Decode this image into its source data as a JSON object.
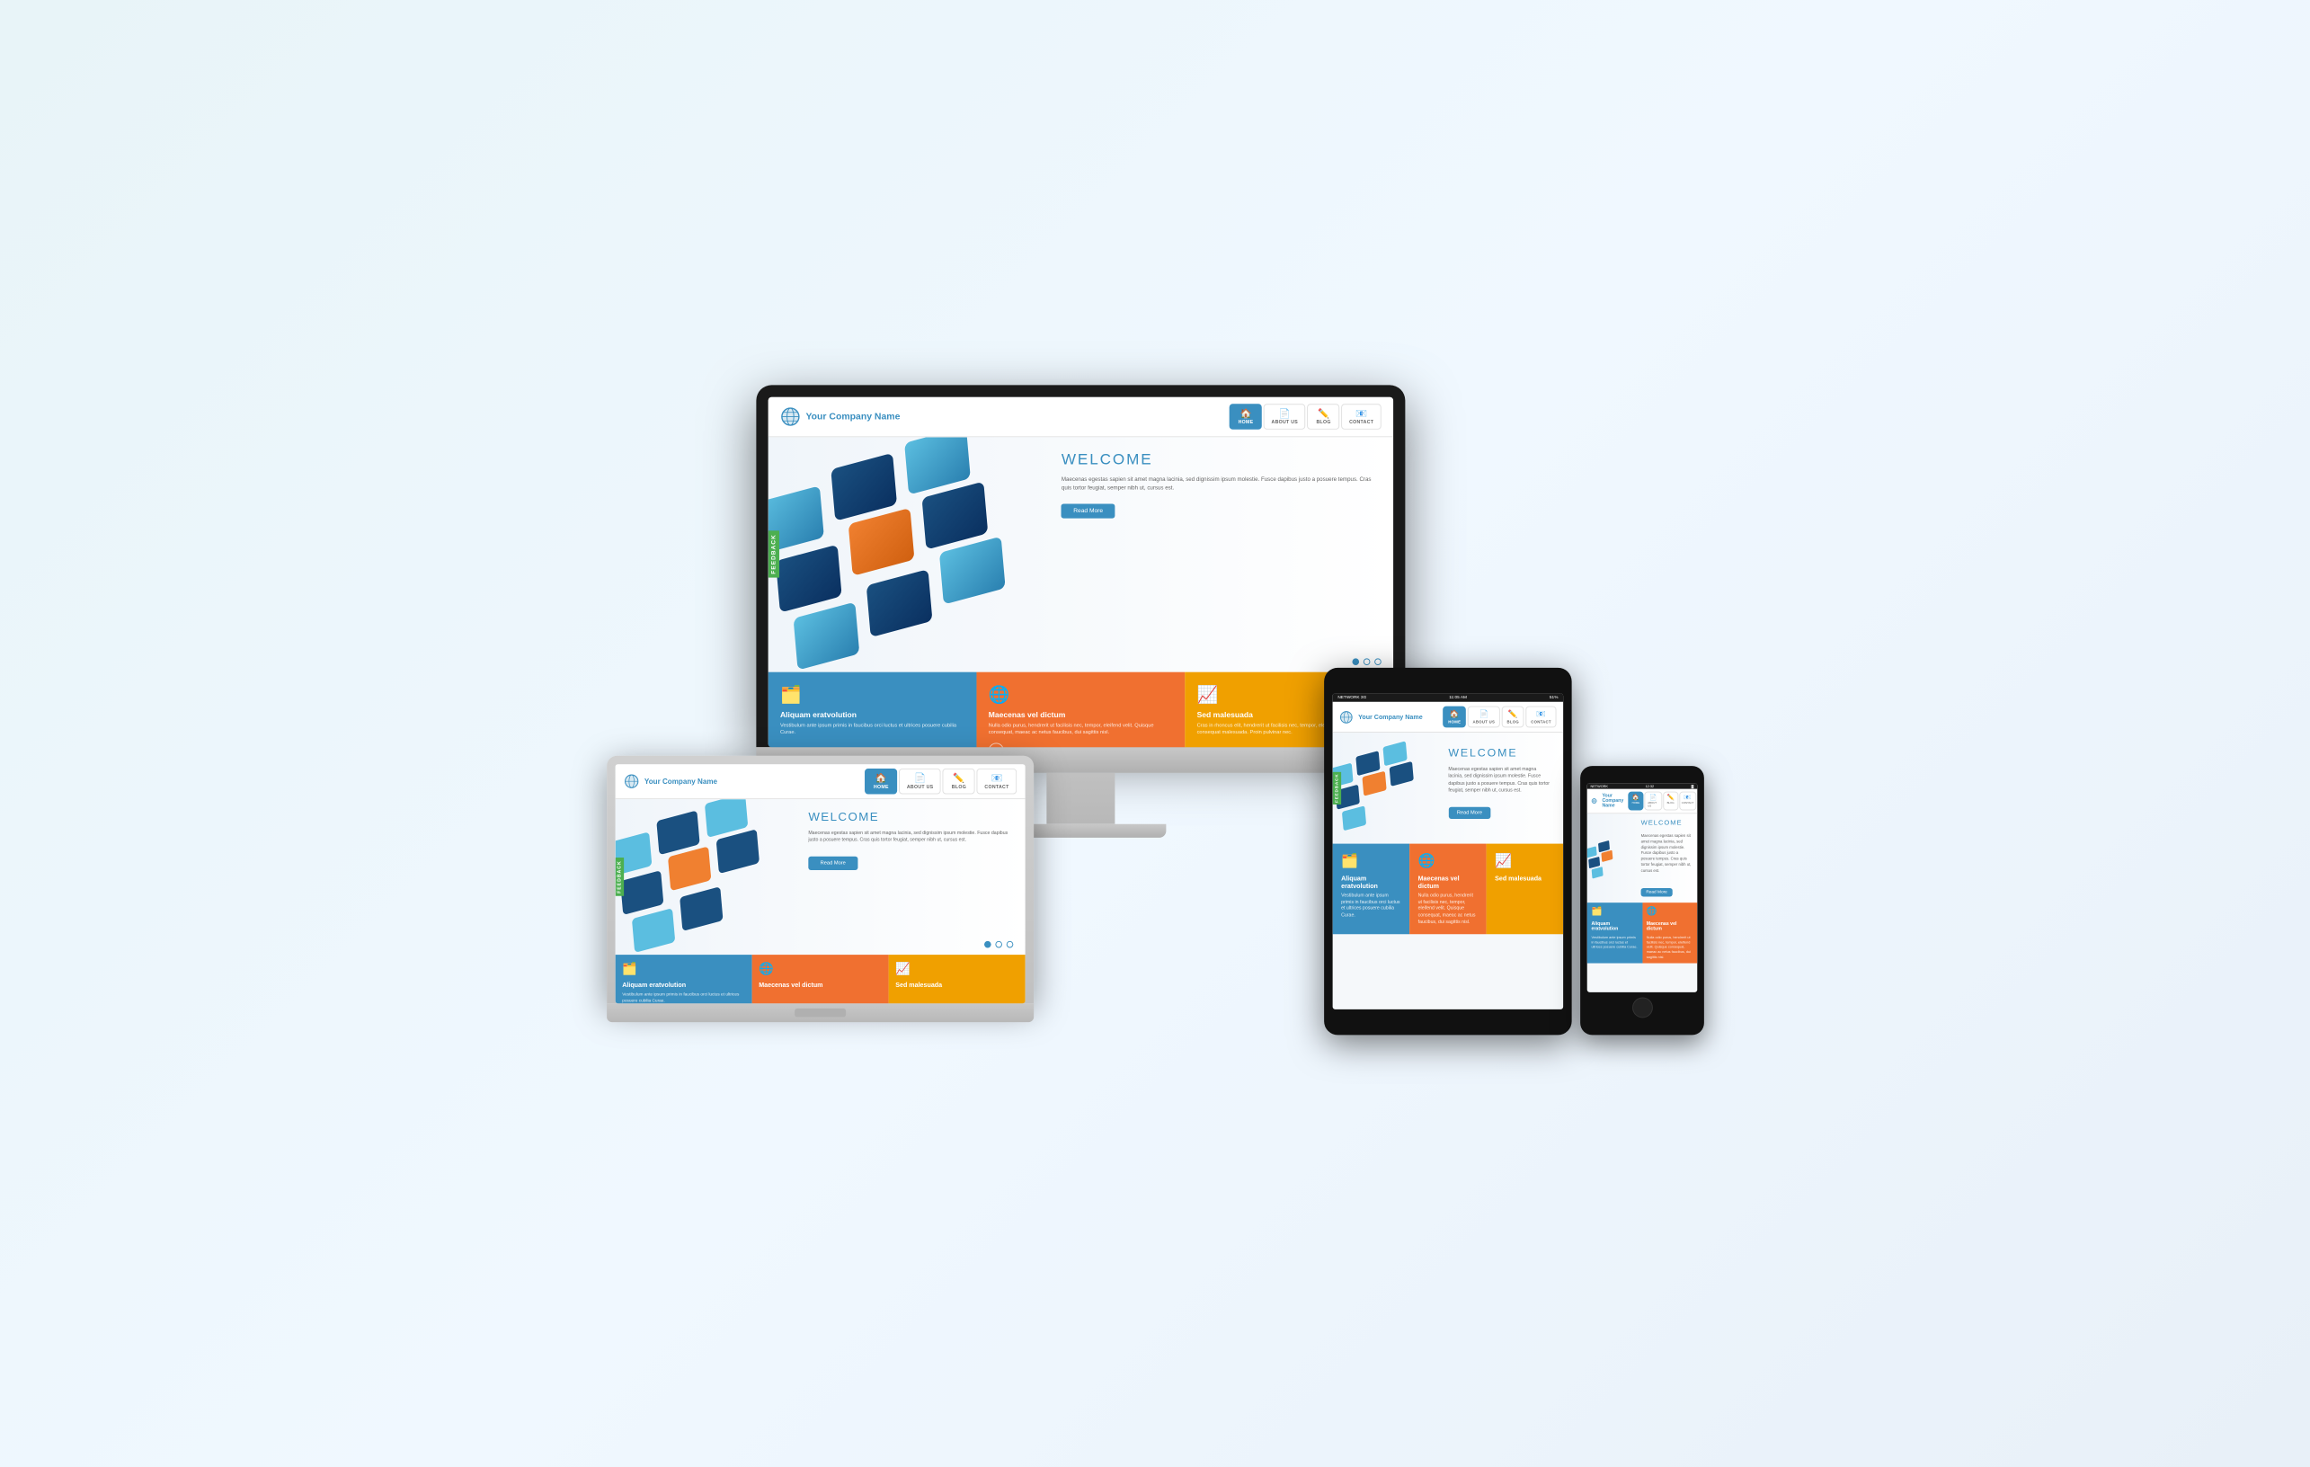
{
  "brand": {
    "company_name": "Your Company Name",
    "logo_icon": "🌐"
  },
  "nav": {
    "items": [
      {
        "label": "HOME",
        "icon": "🏠",
        "active": true
      },
      {
        "label": "ABOUT US",
        "icon": "📄",
        "active": false
      },
      {
        "label": "BLOG",
        "icon": "✏️",
        "active": false
      },
      {
        "label": "CONTACT",
        "icon": "📧",
        "active": false
      }
    ]
  },
  "hero": {
    "title": "WELCOME",
    "body": "Maecenas egestas sapien sit amet magna lacinia, sed dignissim ipsum molestie. Fusce dapibus justo a posuere tempus. Cras quis tortor feugiat, semper nibh ut, cursus est.",
    "button_label": "Read More",
    "feedback_label": "FEEDBACK"
  },
  "features": [
    {
      "title": "Aliquam eratvolution",
      "body": "Vestibulum ante ipsum primis in faucibus orci luctus et ultrices posuere cubilia Curae.",
      "color": "blue",
      "icon": "🗂️"
    },
    {
      "title": "Maecenas vel dictum",
      "body": "Nulla odio purus, hendrerit ut facilisis nec, tempor, eleifend velit. Quisque consequat, maeac ac netus faucibus, dui sagittis nisl.",
      "color": "orange",
      "icon": "🌐",
      "has_arrow": true
    },
    {
      "title": "Sed malesuada",
      "body": "Cras in rhoncus elit, hendrerit ut facilisis nec, tempor, eleifend velit. Quisque consequat malesuada. Proin pulvinar nec.",
      "color": "yellow",
      "icon": "📈"
    }
  ],
  "tablet_status": {
    "network": "NETWORK 3G",
    "time": "11:05 AM",
    "battery": "51%"
  },
  "phone_status": {
    "network": "NETWORK",
    "time": "12:32",
    "battery": "▓"
  }
}
